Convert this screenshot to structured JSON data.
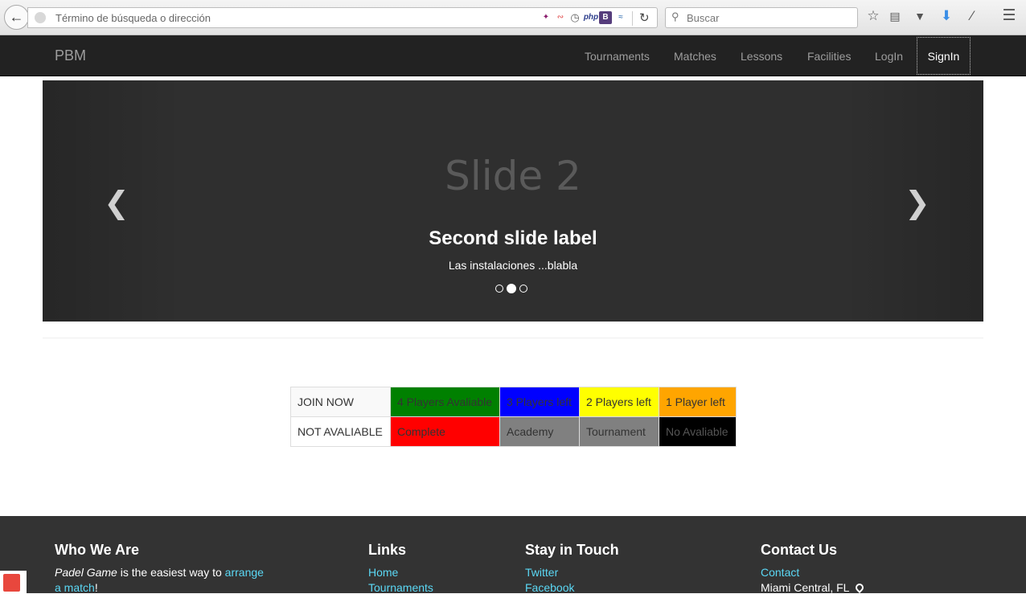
{
  "browser": {
    "url_placeholder": "Término de búsqueda o dirección",
    "search_placeholder": "Buscar",
    "addons": [
      "feather-icon",
      "pdf-icon",
      "clock-icon",
      "php",
      "B",
      "wave-icon"
    ],
    "php_label": "php",
    "b_label": "B"
  },
  "navbar": {
    "brand": "PBM",
    "items": [
      "Tournaments",
      "Matches",
      "Lessons",
      "Facilities",
      "LogIn"
    ],
    "signin": "SignIn"
  },
  "carousel": {
    "slide_title": "Slide 2",
    "caption_title": "Second slide label",
    "caption_text": "Las instalaciones ...blabla",
    "slide_count": 3,
    "active_slide": 2
  },
  "legend": {
    "rows": [
      [
        {
          "text": "JOIN NOW",
          "bg": "#f9f9f9",
          "color": "#333333"
        },
        {
          "text": "4 Players Avaliable",
          "bg": "#008000",
          "color": "#333333"
        },
        {
          "text": "3 Players left",
          "bg": "#0000ff",
          "color": "#333333"
        },
        {
          "text": "2 Players left",
          "bg": "#ffff00",
          "color": "#333333"
        },
        {
          "text": "1 Player left",
          "bg": "#ffa500",
          "color": "#333333"
        }
      ],
      [
        {
          "text": "NOT AVALIABLE",
          "bg": "#ffffff",
          "color": "#333333"
        },
        {
          "text": "Complete",
          "bg": "#ff0000",
          "color": "#333333"
        },
        {
          "text": "Academy",
          "bg": "#808080",
          "color": "#333333"
        },
        {
          "text": "Tournament",
          "bg": "#808080",
          "color": "#333333"
        },
        {
          "text": "No Avaliable",
          "bg": "#000000",
          "color": "#555555"
        }
      ]
    ]
  },
  "footer": {
    "who": {
      "title": "Who We Are",
      "em": "Padel Game",
      "text1": " is the easiest way to ",
      "link1": "arrange",
      "link2": "a match",
      "text2": "!"
    },
    "links": {
      "title": "Links",
      "items": [
        "Home",
        "Tournaments"
      ]
    },
    "touch": {
      "title": "Stay in Touch",
      "items": [
        "Twitter",
        "Facebook"
      ]
    },
    "contact": {
      "title": "Contact Us",
      "link": "Contact",
      "location": "Miami Central, FL"
    }
  },
  "colors": {
    "navbar_bg": "#222222",
    "footer_bg": "#333333",
    "footer_link": "#5bd8f5",
    "carousel_bg": "#2f2f2f"
  }
}
